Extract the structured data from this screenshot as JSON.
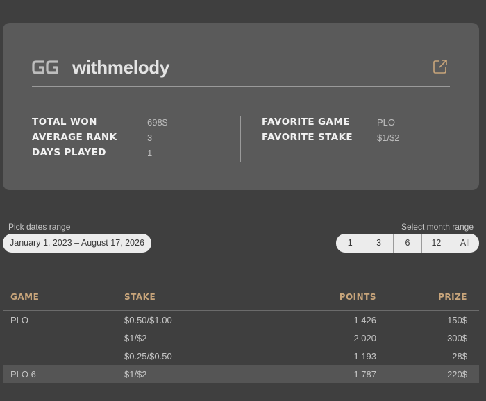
{
  "profile": {
    "username": "withmelody",
    "logo_icon": "gg-logo-icon",
    "share_icon": "external-link-icon",
    "stats_left": [
      {
        "label": "TOTAL WON",
        "value": "698$"
      },
      {
        "label": "AVERAGE RANK",
        "value": "3"
      },
      {
        "label": "DAYS PLAYED",
        "value": "1"
      }
    ],
    "stats_right": [
      {
        "label": "FAVORITE GAME",
        "value": "PLO"
      },
      {
        "label": "FAVORITE STAKE",
        "value": "$1/$2"
      }
    ]
  },
  "range": {
    "dates_label": "Pick dates range",
    "dates_value": "January 1, 2023 – August 17, 2026",
    "month_label": "Select month range",
    "month_options": [
      "1",
      "3",
      "6",
      "12",
      "All"
    ]
  },
  "table": {
    "headers": {
      "game": "GAME",
      "stake": "STAKE",
      "points": "POINTS",
      "prize": "PRIZE"
    },
    "rows": [
      {
        "game": "PLO",
        "stake": "$0.50/$1.00",
        "points": "1 426",
        "prize": "150$"
      },
      {
        "game": "",
        "stake": "$1/$2",
        "points": "2 020",
        "prize": "300$"
      },
      {
        "game": "",
        "stake": "$0.25/$0.50",
        "points": "1 193",
        "prize": "28$"
      },
      {
        "game": "PLO 6",
        "stake": "$1/$2",
        "points": "1 787",
        "prize": "220$"
      }
    ]
  },
  "colors": {
    "background": "#3f3f3f",
    "card": "#5a5a5a",
    "accent": "#c8a57b",
    "pill": "#ececec"
  }
}
